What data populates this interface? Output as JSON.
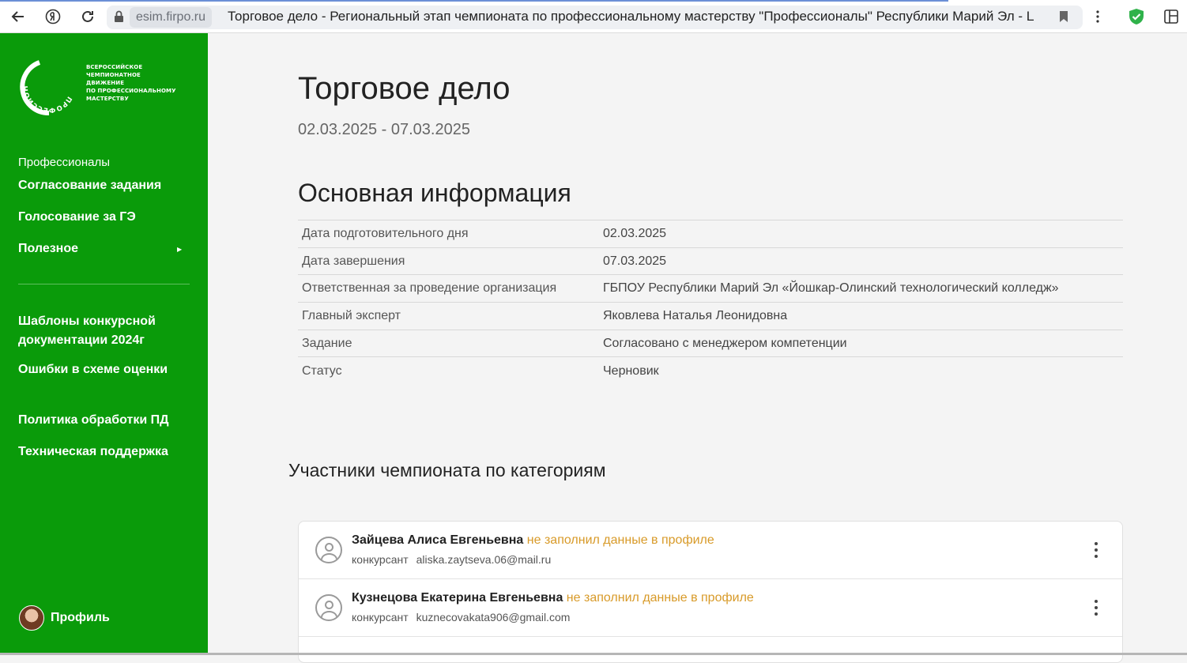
{
  "browser": {
    "domain": "esim.firpo.ru",
    "page_title": "Торговое дело - Региональный этап чемпионата по профессиональному мастерству \"Профессионалы\" Республики Марий Эл - Цифр..."
  },
  "sidebar": {
    "logo_ring_text": "ПРОФЕССИОНАЛЫ",
    "logo_lines": [
      "ВСЕРОССИЙСКОЕ",
      "ЧЕМПИОНАТНОЕ",
      "ДВИЖЕНИЕ",
      "ПО ПРОФЕССИОНАЛЬНОМУ",
      "МАСТЕРСТВУ"
    ],
    "section_label": "Профессионалы",
    "items": [
      {
        "label": "Согласование задания"
      },
      {
        "label": "Голосование за ГЭ"
      },
      {
        "label": "Полезное"
      },
      {
        "label": "Шаблоны конкурсной документации 2024г"
      },
      {
        "label": "Ошибки в схеме оценки"
      },
      {
        "label": "Политика обработки ПД"
      },
      {
        "label": "Техническая поддержка"
      }
    ],
    "profile_label": "Профиль"
  },
  "main": {
    "title": "Торговое дело",
    "date_range": "02.03.2025 - 07.03.2025",
    "info_heading": "Основная информация",
    "info_rows": [
      {
        "key": "Дата подготовительного дня",
        "value": "02.03.2025"
      },
      {
        "key": "Дата завершения",
        "value": "07.03.2025"
      },
      {
        "key": "Ответственная за проведение организация",
        "value": "ГБПОУ Республики Марий Эл «Йошкар-Олинский технологический колледж»"
      },
      {
        "key": "Главный эксперт",
        "value": "Яковлева Наталья Леонидовна"
      },
      {
        "key": "Задание",
        "value": "Согласовано с менеджером компетенции"
      },
      {
        "key": "Статус",
        "value": "Черновик"
      }
    ],
    "participants_heading": "Участники чемпионата по категориям",
    "participants": [
      {
        "name": "Зайцева Алиса Евгеньевна",
        "warning": "не заполнил данные в профиле",
        "role": "конкурсант",
        "email": "aliska.zaytseva.06@mail.ru"
      },
      {
        "name": "Кузнецова Екатерина Евгеньевна",
        "warning": "не заполнил данные в профиле",
        "role": "конкурсант",
        "email": "kuznecovakata906@gmail.com"
      }
    ]
  }
}
